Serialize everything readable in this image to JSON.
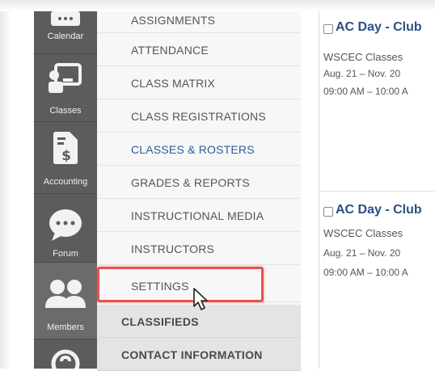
{
  "sidebar_icons": [
    {
      "label": "Calendar",
      "icon": "calendar-icon"
    },
    {
      "label": "Classes",
      "icon": "classroom-icon"
    },
    {
      "label": "Accounting",
      "icon": "invoice-dollar-icon"
    },
    {
      "label": "Forum",
      "icon": "chat-bubble-icon"
    },
    {
      "label": "Members",
      "icon": "users-icon"
    },
    {
      "label": "",
      "icon": "help-icon"
    }
  ],
  "menu": {
    "items": [
      {
        "label": "ASSIGNMENTS"
      },
      {
        "label": "ATTENDANCE"
      },
      {
        "label": "CLASS MATRIX"
      },
      {
        "label": "CLASS REGISTRATIONS"
      },
      {
        "label": "CLASSES & ROSTERS"
      },
      {
        "label": "GRADES & REPORTS"
      },
      {
        "label": "INSTRUCTIONAL MEDIA"
      },
      {
        "label": "INSTRUCTORS"
      },
      {
        "label": "SETTINGS"
      }
    ],
    "groups": [
      {
        "label": "CLASSIFIEDS"
      },
      {
        "label": "CONTACT INFORMATION"
      }
    ],
    "highlight_color": "#e8524a"
  },
  "cards": [
    {
      "title": "AC Day - Club",
      "org": "WSCEC Classes",
      "dates": "Aug. 21 – Nov. 20",
      "time": "09:00 AM – 10:00 A"
    },
    {
      "title": "AC Day - Club",
      "org": "WSCEC Classes",
      "dates": "Aug. 21 – Nov. 20",
      "time": "09:00 AM – 10:00 A"
    }
  ],
  "colors": {
    "accent": "#2d5a9c",
    "sidebar": "#5c5c5c"
  }
}
